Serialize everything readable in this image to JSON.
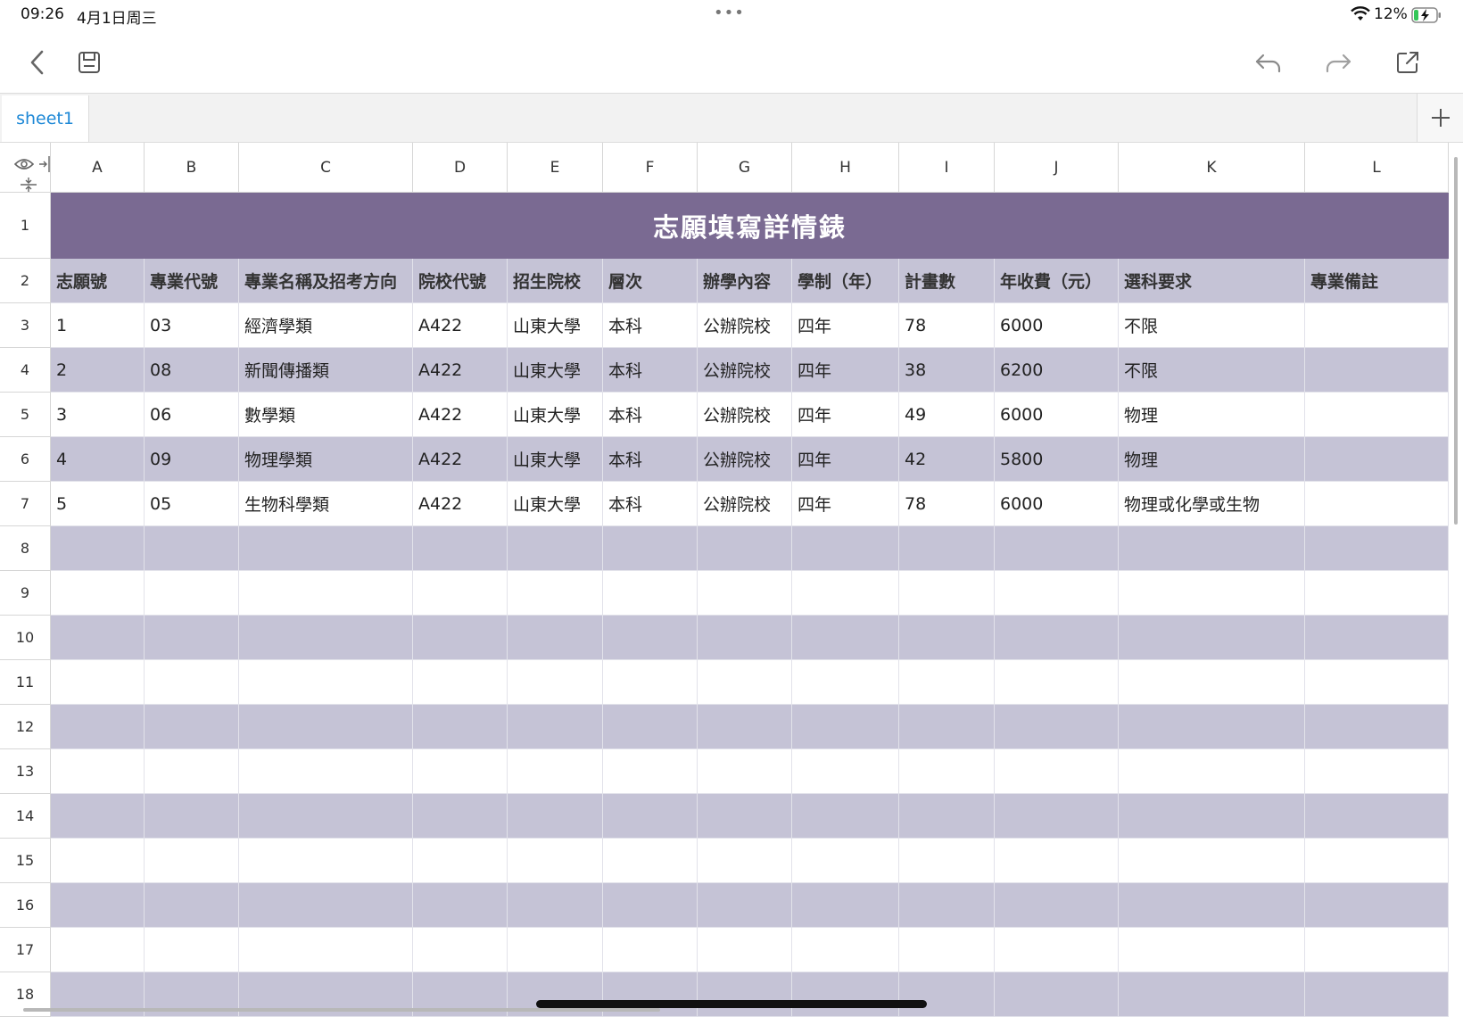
{
  "status": {
    "time": "09:26",
    "date": "4月1日周三",
    "battery_pct": "12%"
  },
  "toolbar": {
    "icons": [
      "back-icon",
      "save-icon",
      "undo-icon",
      "redo-icon",
      "share-icon"
    ]
  },
  "sheets": {
    "tabs": [
      "sheet1"
    ],
    "active": "sheet1"
  },
  "grid": {
    "columns": [
      "A",
      "B",
      "C",
      "D",
      "E",
      "F",
      "G",
      "H",
      "I",
      "J",
      "K",
      "L"
    ],
    "row_numbers": [
      "1",
      "2",
      "3",
      "4",
      "5",
      "6",
      "7",
      "8",
      "9",
      "10",
      "11",
      "12",
      "13",
      "14",
      "15",
      "16",
      "17",
      "18"
    ],
    "title": "志願填寫詳情錶",
    "headers": [
      "志願號",
      "專業代號",
      "專業名稱及招考方向",
      "院校代號",
      "招生院校",
      "層次",
      "辦學內容",
      "學制（年）",
      "計畫數",
      "年收費（元）",
      "選科要求",
      "專業備註"
    ],
    "rows": [
      [
        "1",
        "03",
        "經濟學類",
        "A422",
        "山東大學",
        "本科",
        "公辦院校",
        "四年",
        "78",
        "6000",
        "不限",
        ""
      ],
      [
        "2",
        "08",
        "新聞傳播類",
        "A422",
        "山東大學",
        "本科",
        "公辦院校",
        "四年",
        "38",
        "6200",
        "不限",
        ""
      ],
      [
        "3",
        "06",
        "數學類",
        "A422",
        "山東大學",
        "本科",
        "公辦院校",
        "四年",
        "49",
        "6000",
        "物理",
        ""
      ],
      [
        "4",
        "09",
        "物理學類",
        "A422",
        "山東大學",
        "本科",
        "公辦院校",
        "四年",
        "42",
        "5800",
        "物理",
        ""
      ],
      [
        "5",
        "05",
        "生物科學類",
        "A422",
        "山東大學",
        "本科",
        "公辦院校",
        "四年",
        "78",
        "6000",
        "物理或化學或生物",
        ""
      ]
    ]
  },
  "colors": {
    "title_bg": "#7a6a92",
    "band_bg": "#c5c3d6",
    "tab_accent": "#1e88d6"
  }
}
